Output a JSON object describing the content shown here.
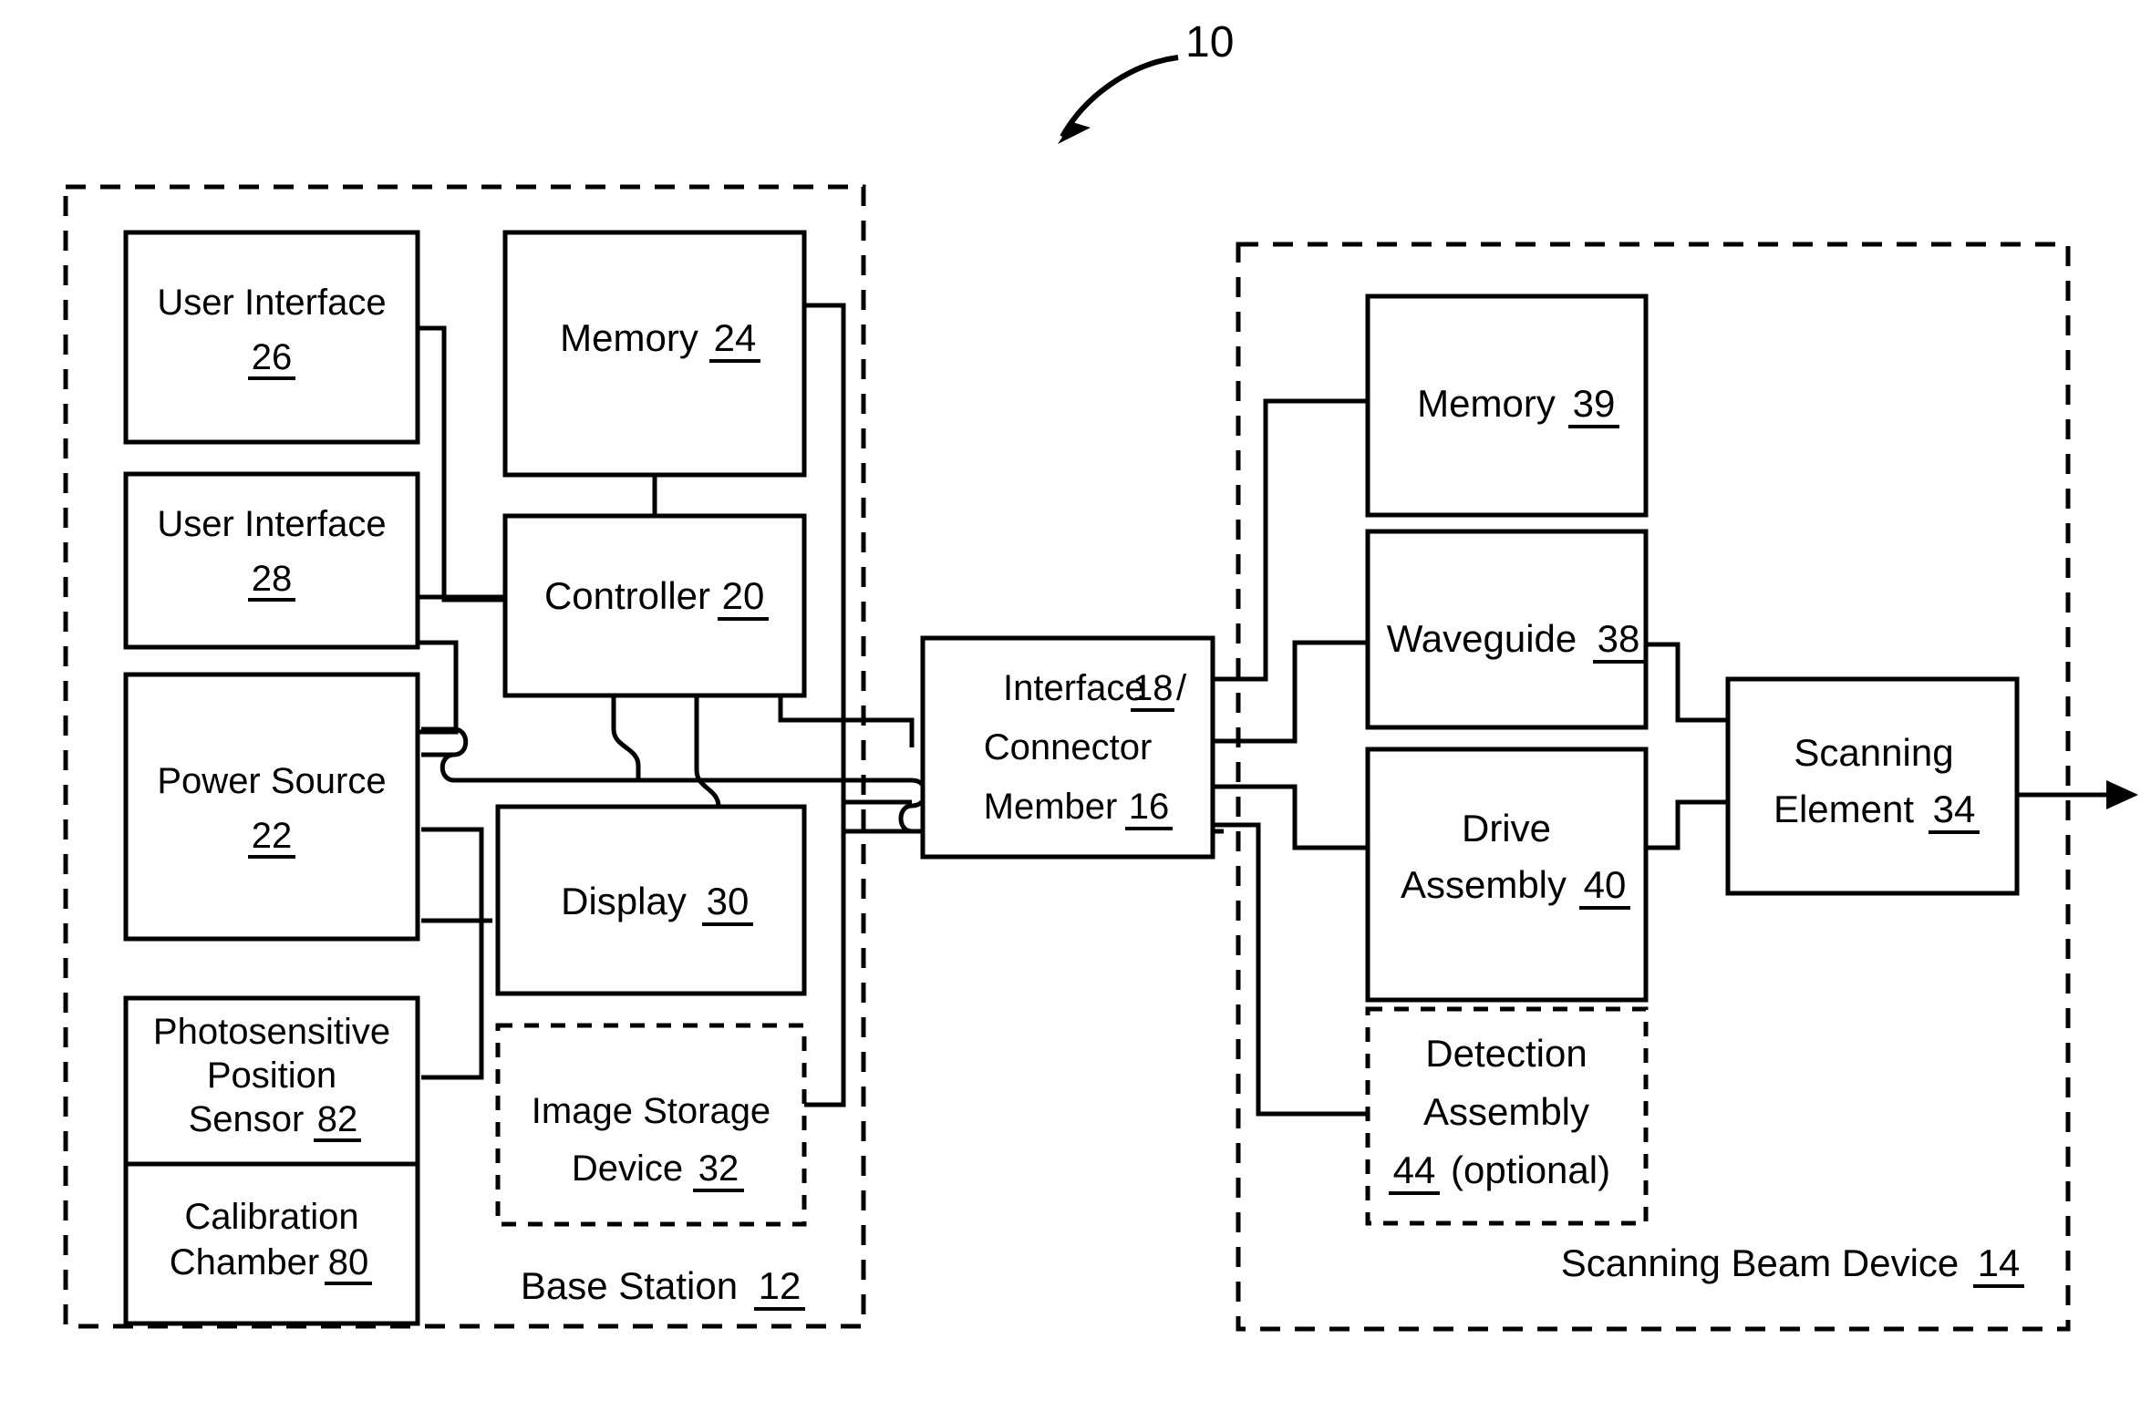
{
  "figure": {
    "reference_numeral": "10"
  },
  "base_station": {
    "label": "Base Station",
    "ref": "12",
    "blocks": [
      {
        "id": "user-interface-26",
        "lines": [
          "User Interface"
        ],
        "ref": "26",
        "ref_inline": false,
        "style": "solid"
      },
      {
        "id": "user-interface-28",
        "lines": [
          "User Interface"
        ],
        "ref": "28",
        "ref_inline": false,
        "style": "solid"
      },
      {
        "id": "power-source-22",
        "lines": [
          "Power Source"
        ],
        "ref": "22",
        "ref_inline": false,
        "style": "solid"
      },
      {
        "id": "photosensitive-position-sensor-82",
        "lines": [
          "Photosensitive",
          "Position",
          "Sensor"
        ],
        "ref": "82",
        "ref_inline": true,
        "style": "solid"
      },
      {
        "id": "calibration-chamber-80",
        "lines": [
          "Calibration",
          "Chamber"
        ],
        "ref": "80",
        "ref_inline": true,
        "style": "solid"
      },
      {
        "id": "memory-24",
        "lines": [
          "Memory"
        ],
        "ref": "24",
        "ref_inline": true,
        "style": "solid"
      },
      {
        "id": "controller-20",
        "lines": [
          "Controller"
        ],
        "ref": "20",
        "ref_inline": true,
        "style": "solid"
      },
      {
        "id": "display-30",
        "lines": [
          "Display"
        ],
        "ref": "30",
        "ref_inline": true,
        "style": "solid"
      },
      {
        "id": "image-storage-device-32",
        "lines": [
          "Image Storage",
          "Device"
        ],
        "ref": "32",
        "ref_inline": true,
        "style": "dotted"
      }
    ],
    "text": {
      "user_interface_26_line1": "User Interface",
      "user_interface_26_ref": "26",
      "user_interface_28_line1": "User Interface",
      "user_interface_28_ref": "28",
      "power_source_line1": "Power Source",
      "power_source_ref": "22",
      "photosensitive_line1": "Photosensitive",
      "photosensitive_line2": "Position",
      "photosensitive_line3": "Sensor",
      "photosensitive_ref": "82",
      "calibration_line1": "Calibration",
      "calibration_line2": "Chamber",
      "calibration_ref": "80",
      "memory_label": "Memory",
      "memory_ref": "24",
      "controller_label": "Controller",
      "controller_ref": "20",
      "display_label": "Display",
      "display_ref": "30",
      "image_storage_line1": "Image Storage",
      "image_storage_line2": "Device",
      "image_storage_ref": "32",
      "base_station_label": "Base Station",
      "base_station_ref": "12"
    }
  },
  "interface_connector": {
    "line1": "Interface",
    "ref1": "18",
    "slash": "/",
    "line2": "Connector",
    "line3": "Member",
    "ref2": "16"
  },
  "scanning_beam_device": {
    "label": "Scanning Beam Device",
    "ref": "14",
    "text": {
      "memory_label": "Memory",
      "memory_ref": "39",
      "waveguide_label": "Waveguide",
      "waveguide_ref": "38",
      "drive_line1": "Drive",
      "drive_line2": "Assembly",
      "drive_ref": "40",
      "detection_line1": "Detection",
      "detection_line2": "Assembly",
      "detection_ref": "44",
      "detection_optional": "(optional)",
      "scanning_element_line1": "Scanning",
      "scanning_element_line2": "Element",
      "scanning_element_ref": "34",
      "device_label": "Scanning Beam Device",
      "device_ref": "14"
    }
  },
  "colors": {
    "ink": "#000000",
    "paper": "#ffffff"
  }
}
